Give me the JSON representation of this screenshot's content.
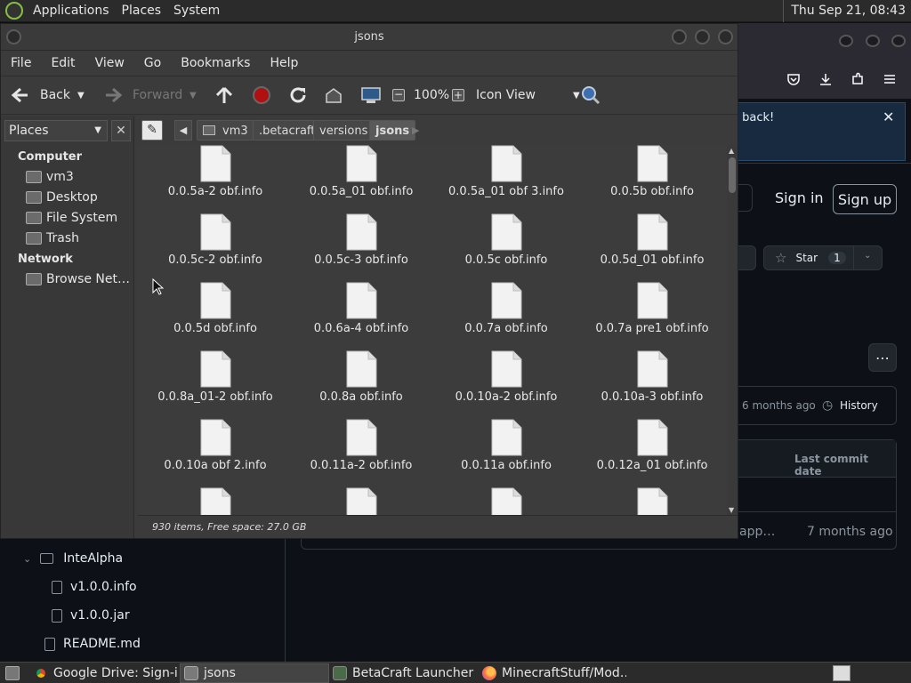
{
  "top_panel": {
    "menus": [
      "Applications",
      "Places",
      "System"
    ],
    "clock": "Thu Sep 21, 08:43"
  },
  "window": {
    "title": "jsons",
    "menus": [
      "File",
      "Edit",
      "View",
      "Go",
      "Bookmarks",
      "Help"
    ]
  },
  "toolbar": {
    "back": "Back",
    "forward": "Forward",
    "zoom": "100%",
    "view_mode": "Icon View"
  },
  "breadcrumbs": [
    "vm3",
    ".betacraft",
    "versions",
    "jsons"
  ],
  "sidebar": {
    "selector": "Places",
    "sections": [
      {
        "title": "Computer",
        "items": [
          "vm3",
          "Desktop",
          "File System",
          "Trash"
        ]
      },
      {
        "title": "Network",
        "items": [
          "Browse Net…"
        ]
      }
    ]
  },
  "files": [
    "0.0.5a-2 obf.info",
    "0.0.5a_01 obf.info",
    "0.0.5a_01 obf 3.info",
    "0.0.5b obf.info",
    "0.0.5c-2 obf.info",
    "0.0.5c-3 obf.info",
    "0.0.5c obf.info",
    "0.0.5d_01 obf.info",
    "0.0.5d obf.info",
    "0.0.6a-4 obf.info",
    "0.0.7a obf.info",
    "0.0.7a pre1 obf.info",
    "0.0.8a_01-2 obf.info",
    "0.0.8a obf.info",
    "0.0.10a-2 obf.info",
    "0.0.10a-3 obf.info",
    "0.0.10a obf 2.info",
    "0.0.11a-2 obf.info",
    "0.0.11a obf.info",
    "0.0.12a_01 obf.info",
    "",
    "",
    "",
    ""
  ],
  "status": "930 items, Free space: 27.0 GB",
  "background": {
    "notice": "e back!",
    "sign_in": "Sign in",
    "sign_up": "Sign up",
    "star_label": "Star",
    "star_count": "1",
    "commit_age": "6 months ago",
    "history": "History",
    "last_commit_header": "Last commit date",
    "row_msg": "app…",
    "row_age": "7 months ago",
    "tree": [
      "InteAlpha",
      "v1.0.0.info",
      "v1.0.0.jar",
      "README.md"
    ]
  },
  "taskbar": [
    "Google Drive: Sign-i…",
    "jsons",
    "BetaCraft Launcher …",
    "MinecraftStuff/Mod…"
  ]
}
